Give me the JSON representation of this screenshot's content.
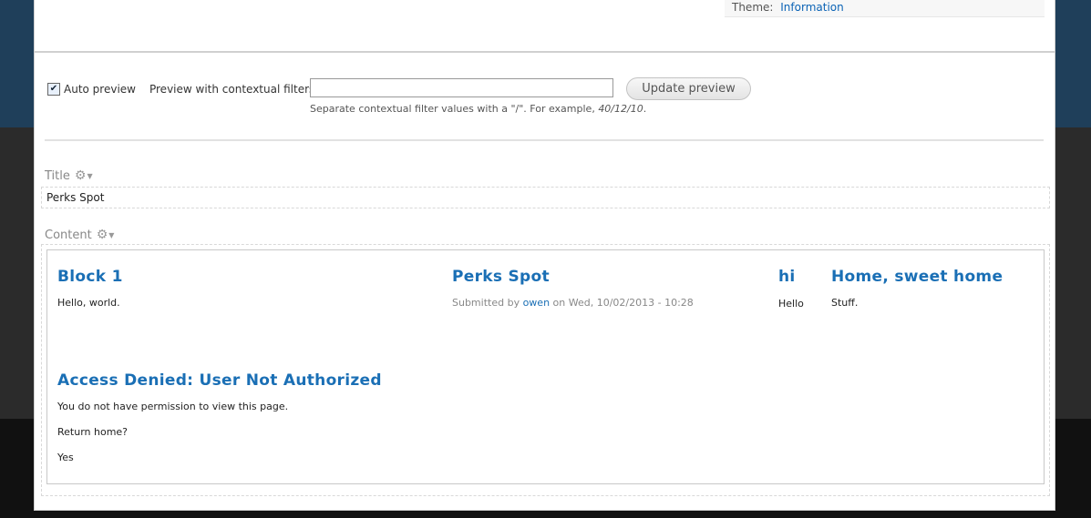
{
  "theme": {
    "label": "Theme:",
    "value": "Information"
  },
  "preview": {
    "auto_preview_label": "Auto preview",
    "auto_preview_checked": true,
    "contextual_filters_label": "Preview with contextual filters:",
    "contextual_filters_value": "",
    "update_button": "Update preview",
    "hint_prefix": "Separate contextual filter values with a \"/\". For example, ",
    "hint_example": "40/12/10",
    "hint_suffix": "."
  },
  "title_section": {
    "label": "Title",
    "value": "Perks Spot"
  },
  "content_section": {
    "label": "Content",
    "blocks": [
      {
        "title": "Block 1",
        "body": "Hello, world."
      },
      {
        "title": "Perks Spot",
        "submitted_prefix": "Submitted by",
        "author": "owen",
        "submitted_suffix": "on Wed, 10/02/2013 - 10:28"
      },
      {
        "title": "hi",
        "body": "Hello"
      },
      {
        "title": "Home, sweet home",
        "body": "Stuff."
      },
      {
        "title": "Access Denied: User Not Authorized",
        "lines": [
          "You do not have permission to view this page.",
          "Return home?",
          "Yes"
        ]
      }
    ]
  },
  "icons": {
    "gear": "gear-icon",
    "caret": "chevron-down-icon",
    "checkbox": "checkmark-icon"
  }
}
